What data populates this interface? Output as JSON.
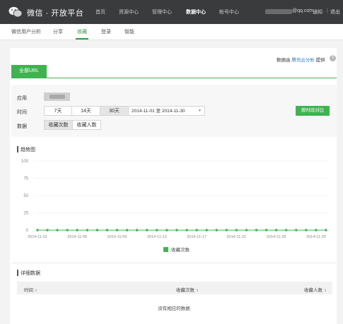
{
  "topbar": {
    "brand": "微信 · 开放平台",
    "nav": [
      "首页",
      "资源中心",
      "管理中心",
      "数据中心",
      "帐号中心"
    ],
    "active_nav": "数据中心",
    "email_suffix": "@qq.com",
    "notice": "通知",
    "logout": "退出"
  },
  "subnav": {
    "items": [
      "微信用户分析",
      "分享",
      "收藏",
      "登录",
      "智能"
    ],
    "active": "收藏"
  },
  "provider": {
    "prefix": "数据由",
    "link": "腾讯云分析",
    "suffix": "提供"
  },
  "url_tab": "全部URL",
  "filters": {
    "app_label": "应用",
    "time_label": "时间",
    "data_label": "数据",
    "time_buttons": [
      "7天",
      "14天",
      "30天"
    ],
    "selected_time": "30天",
    "date_range": "2014-11-01 至 2014-11-30",
    "data_buttons": [
      "收藏次数",
      "收藏人数"
    ],
    "selected_data": "收藏次数",
    "compare_button": "按时段对比"
  },
  "trend": {
    "title": "趋势图"
  },
  "chart_data": {
    "type": "line",
    "title": "趋势图",
    "xlabel": "",
    "ylabel": "",
    "ylim": [
      0,
      100
    ],
    "yticks": [
      0,
      25,
      50,
      75,
      100
    ],
    "x": [
      "2014-11-01",
      "2014-11-02",
      "2014-11-03",
      "2014-11-04",
      "2014-11-05",
      "2014-11-06",
      "2014-11-07",
      "2014-11-08",
      "2014-11-09",
      "2014-11-10",
      "2014-11-11",
      "2014-11-12",
      "2014-11-13",
      "2014-11-14",
      "2014-11-15",
      "2014-11-16",
      "2014-11-17",
      "2014-11-18",
      "2014-11-19",
      "2014-11-20",
      "2014-11-21",
      "2014-11-22",
      "2014-11-23",
      "2014-11-24",
      "2014-11-25",
      "2014-11-26",
      "2014-11-27",
      "2014-11-28",
      "2014-11-29",
      "2014-11-30"
    ],
    "xtick_labels": [
      "2014-11-01",
      "2014-11-05",
      "2014-11-09",
      "2014-11-13",
      "2014-11-17",
      "2014-11-21",
      "2014-11-25",
      "2014-11-29"
    ],
    "series": [
      {
        "name": "收藏次数",
        "color": "#3fb350",
        "values": [
          0,
          0,
          0,
          0,
          0,
          0,
          0,
          0,
          0,
          0,
          0,
          0,
          0,
          0,
          0,
          0,
          0,
          0,
          0,
          0,
          0,
          0,
          0,
          0,
          0,
          0,
          0,
          0,
          0,
          0
        ]
      }
    ],
    "grid": true,
    "legend": "bottom-center"
  },
  "detail": {
    "title": "详细数据",
    "columns": [
      "时间",
      "收藏次数",
      "收藏人数"
    ],
    "sort_glyph": "⇕",
    "empty": "没有相应的数据"
  },
  "colors": {
    "topbar": "#3a3b3d",
    "accent": "#3fb350",
    "link": "#2b7ac4"
  }
}
